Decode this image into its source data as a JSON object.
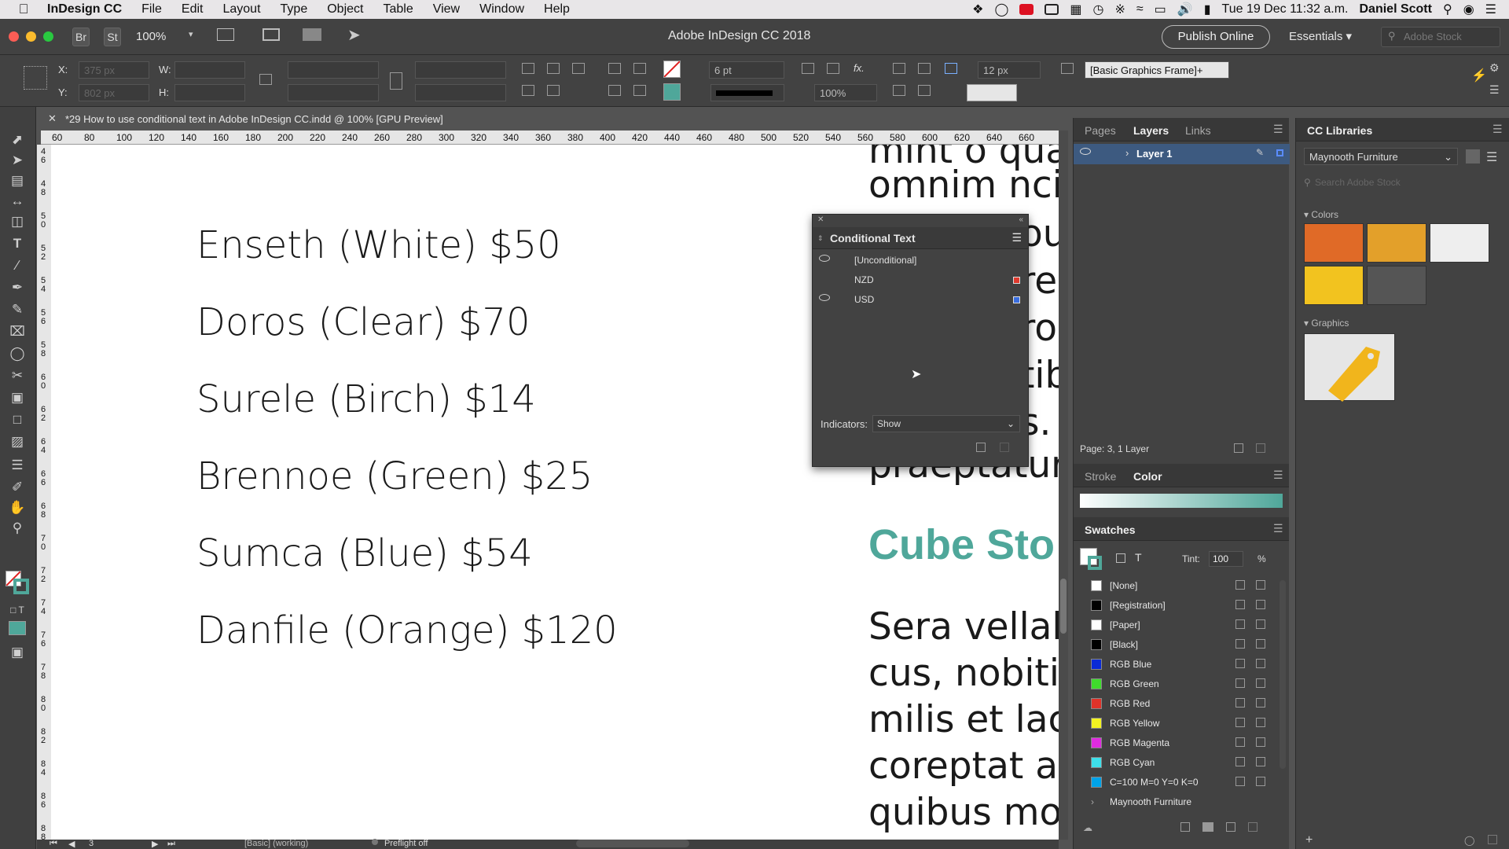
{
  "menubar": {
    "app_name": "InDesign CC",
    "items": [
      "File",
      "Edit",
      "Layout",
      "Type",
      "Object",
      "Table",
      "View",
      "Window",
      "Help"
    ],
    "clock": "Tue 19 Dec  11:32 a.m.",
    "user": "Daniel Scott"
  },
  "titlebar": {
    "br_label": "Br",
    "st_label": "St",
    "zoom": "100%",
    "title": "Adobe InDesign CC 2018",
    "publish_label": "Publish Online",
    "workspace": "Essentials",
    "stock_placeholder": "Adobe Stock"
  },
  "controlbar": {
    "x_label": "X:",
    "x_value": "375 px",
    "y_label": "Y:",
    "y_value": "802 px",
    "w_label": "W:",
    "h_label": "H:",
    "stroke_weight": "6 pt",
    "opacity": "100%",
    "offset": "12 px",
    "object_style": "[Basic Graphics Frame]+"
  },
  "document": {
    "tab_title": "*29 How to use conditional text in Adobe InDesign CC.indd @ 100% [GPU Preview]",
    "ruler_ticks": [
      "60",
      "80",
      "100",
      "120",
      "140",
      "160",
      "180",
      "200",
      "220",
      "240",
      "260",
      "280",
      "300",
      "320",
      "340",
      "360",
      "380",
      "400",
      "420",
      "440",
      "460",
      "480",
      "500",
      "520",
      "540",
      "560",
      "580",
      "600",
      "620",
      "640",
      "660"
    ],
    "vruler_ticks": [
      "4 6",
      "4 8",
      "5 0",
      "5 2",
      "5 4",
      "5 6",
      "5 8",
      "6 0",
      "6 2",
      "6 4",
      "6 6",
      "6 8",
      "7 0",
      "7 2",
      "7 4",
      "7 6",
      "7 8",
      "8 0",
      "8 2",
      "8 4",
      "8 6",
      "8 8"
    ],
    "prices": [
      "Enseth (White) $50",
      "Doros (Clear) $70",
      "Surele (Birch) $14",
      "Brennoe (Green) $25",
      "Sumca (Blue) $54",
      "Danfile (Orange) $120"
    ],
    "col2_lines": [
      "mint o qua",
      "omnim ncia",
      "ou",
      "re",
      "ro",
      "tib",
      "s.",
      "praeptatur,"
    ],
    "heading": "Cube Sto",
    "body_lines": [
      "Sera vellabo",
      "cus, nobiti a",
      "milis et laco",
      "coreptat at",
      "quibus mol"
    ]
  },
  "conditional_text": {
    "title": "Conditional Text",
    "conditions": [
      {
        "name": "[Unconditional]",
        "visible": true,
        "color": ""
      },
      {
        "name": "NZD",
        "visible": false,
        "color": "#e03a2e"
      },
      {
        "name": "USD",
        "visible": true,
        "color": "#3a6ee0"
      }
    ],
    "indicators_label": "Indicators:",
    "indicators_value": "Show"
  },
  "layers_panel": {
    "tabs": [
      "Pages",
      "Layers",
      "Links"
    ],
    "layer_name": "Layer 1",
    "status": "Page: 3, 1 Layer"
  },
  "color_panel": {
    "tabs": [
      "Stroke",
      "Color"
    ]
  },
  "swatches_panel": {
    "title": "Swatches",
    "tint_label": "Tint:",
    "tint_value": "100",
    "tint_unit": "%",
    "swatches": [
      {
        "name": "[None]",
        "color": "#ffffff"
      },
      {
        "name": "[Registration]",
        "color": "#000000"
      },
      {
        "name": "[Paper]",
        "color": "#ffffff"
      },
      {
        "name": "[Black]",
        "color": "#000000"
      },
      {
        "name": "RGB Blue",
        "color": "#0a2bd6"
      },
      {
        "name": "RGB Green",
        "color": "#3fdc2c"
      },
      {
        "name": "RGB Red",
        "color": "#e0332a"
      },
      {
        "name": "RGB Yellow",
        "color": "#f3f321"
      },
      {
        "name": "RGB Magenta",
        "color": "#df2bdf"
      },
      {
        "name": "RGB Cyan",
        "color": "#3ee0ea"
      },
      {
        "name": "C=100 M=0 Y=0 K=0",
        "color": "#00a3e8"
      },
      {
        "name": "Maynooth Furniture",
        "color": ""
      }
    ]
  },
  "cc_libraries": {
    "title": "CC Libraries",
    "library": "Maynooth Furniture",
    "search_placeholder": "Search Adobe Stock",
    "colors_label": "Colors",
    "colors": [
      "#e06a27",
      "#e3a02a",
      "#eeeeee",
      "#f2c31f",
      "#555555"
    ],
    "graphics_label": "Graphics"
  },
  "statusbar": {
    "page": "3",
    "style": "[Basic] (working)",
    "preflight": "Preflight off"
  }
}
